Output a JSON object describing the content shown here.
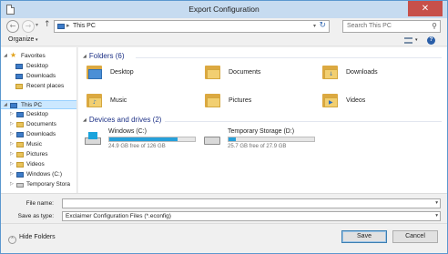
{
  "window": {
    "title": "Export Configuration",
    "close_glyph": "✕"
  },
  "nav": {
    "back_glyph": "←",
    "forward_glyph": "→",
    "recent_glyph": "▾",
    "up_glyph": "↑",
    "address_sep": "▸",
    "address": "This PC",
    "address_dropdown_glyph": "▾",
    "refresh_glyph": "↻",
    "search_placeholder": "Search This PC",
    "search_glyph": "⚲"
  },
  "toolbar": {
    "organize_label": "Organize",
    "chevron": "▾",
    "help_glyph": "?"
  },
  "sidebar": {
    "favorites": {
      "label": "Favorites",
      "items": [
        "Desktop",
        "Downloads",
        "Recent places"
      ]
    },
    "this_pc": {
      "label": "This PC",
      "items": [
        "Desktop",
        "Documents",
        "Downloads",
        "Music",
        "Pictures",
        "Videos",
        "Windows (C:)",
        "Temporary Stora"
      ]
    },
    "expand_glyph": "▷",
    "collapse_glyph": "◢",
    "star_glyph": "★"
  },
  "main": {
    "folders_header": "Folders (6)",
    "folders": [
      "Desktop",
      "Documents",
      "Downloads",
      "Music",
      "Pictures",
      "Videos"
    ],
    "folder_glyphs": [
      "",
      "",
      "↓",
      "♪",
      "",
      "▶"
    ],
    "drives_header": "Devices and drives (2)",
    "header_chevron": "◢",
    "drives": [
      {
        "name": "Windows (C:)",
        "free": "24.9 GB free of 126 GB",
        "used_fraction": 0.8
      },
      {
        "name": "Temporary Storage (D:)",
        "free": "25.7 GB free of 27.9 GB",
        "used_fraction": 0.08
      }
    ]
  },
  "fields": {
    "file_name_label": "File name:",
    "file_name_value": "",
    "save_type_label": "Save as type:",
    "save_type_value": "Exclaimer Configuration Files (*.econfig)",
    "dropdown_glyph": "▾"
  },
  "footer": {
    "hide_folders_label": "Hide Folders",
    "hide_glyph": "⌃",
    "save_label": "Save",
    "cancel_label": "Cancel"
  }
}
